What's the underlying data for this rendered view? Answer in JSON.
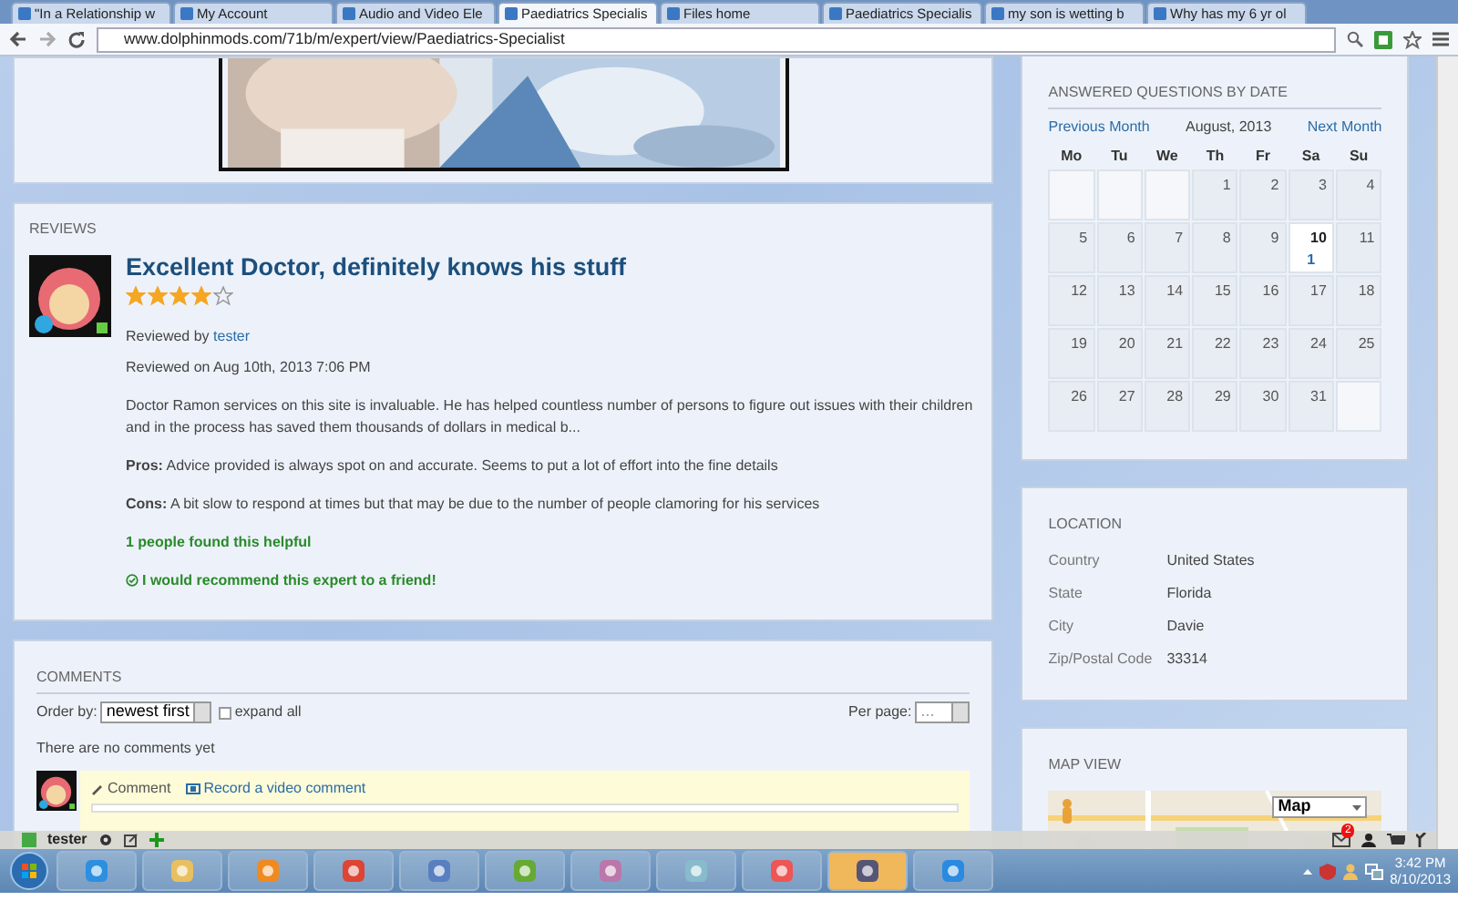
{
  "browser": {
    "tabs": [
      {
        "label": "\"In a Relationship w",
        "selected": false
      },
      {
        "label": "My Account",
        "selected": false
      },
      {
        "label": "Audio and Video Ele",
        "selected": false
      },
      {
        "label": "Paediatrics Specialis",
        "selected": true
      },
      {
        "label": "Files home",
        "selected": false
      },
      {
        "label": "Paediatrics Specialis",
        "selected": false
      },
      {
        "label": "my son is wetting b",
        "selected": false
      },
      {
        "label": "Why has my 6 yr ol",
        "selected": false
      }
    ],
    "url": "www.dolphinmods.com/71b/m/expert/view/Paediatrics-Specialist"
  },
  "reviews": {
    "heading": "REVIEWS",
    "title": "Excellent Doctor, definitely knows his stuff",
    "stars": 4,
    "reviewed_by_label": "Reviewed by",
    "reviewer": "tester",
    "reviewed_on": "Reviewed on Aug 10th, 2013 7:06 PM",
    "body": "Doctor Ramon services on this site is invaluable. He has helped countless number of persons to figure out issues with their children and in the process has saved them thousands of dollars in medical b...",
    "pros": "**Pros:** Advice provided is always spot on and accurate. Seems to put a lot of effort into the fine details",
    "cons": "**Cons:** A bit slow to respond at times but that may be due to the number of people clamoring for his services",
    "helpful": "1 people found this helpful",
    "recommend": "I would recommend this expert to a friend!"
  },
  "comments": {
    "heading": "COMMENTS",
    "order_label": "Order by:",
    "order_value": "newest first",
    "expand_all": {
      "label": "expand all",
      "checked": false
    },
    "per_page_label": "Per page:",
    "per_page_value": "...",
    "empty": "There are no comments yet",
    "comment_tab": "Comment",
    "video_tab": "Record a video comment"
  },
  "calendar": {
    "heading": "ANSWERED QUESTIONS BY DATE",
    "prev": "Previous Month",
    "month": "August, 2013",
    "next": "Next Month",
    "weekdays": [
      "Mo",
      "Tu",
      "We",
      "Th",
      "Fr",
      "Sa",
      "Su"
    ],
    "weeks": [
      [
        {
          "kind": "blank"
        },
        {
          "kind": "blank"
        },
        {
          "kind": "blank"
        },
        {
          "kind": "day",
          "day": "1",
          "selected": false
        },
        {
          "kind": "day",
          "day": "2",
          "selected": false
        },
        {
          "kind": "day",
          "day": "3",
          "selected": false
        },
        {
          "kind": "day",
          "day": "4",
          "selected": false
        }
      ],
      [
        {
          "kind": "day",
          "day": "5",
          "selected": false
        },
        {
          "kind": "day",
          "day": "6",
          "selected": false
        },
        {
          "kind": "day",
          "day": "7",
          "selected": false
        },
        {
          "kind": "day",
          "day": "8",
          "selected": false
        },
        {
          "kind": "day",
          "day": "9",
          "selected": false
        },
        {
          "kind": "day",
          "day": "10",
          "count": "1",
          "selected": true
        },
        {
          "kind": "day",
          "day": "11",
          "selected": false
        }
      ],
      [
        {
          "kind": "day",
          "day": "12",
          "selected": false
        },
        {
          "kind": "day",
          "day": "13",
          "selected": false
        },
        {
          "kind": "day",
          "day": "14",
          "selected": false
        },
        {
          "kind": "day",
          "day": "15",
          "selected": false
        },
        {
          "kind": "day",
          "day": "16",
          "selected": false
        },
        {
          "kind": "day",
          "day": "17",
          "selected": false
        },
        {
          "kind": "day",
          "day": "18",
          "selected": false
        }
      ],
      [
        {
          "kind": "day",
          "day": "19",
          "selected": false
        },
        {
          "kind": "day",
          "day": "20",
          "selected": false
        },
        {
          "kind": "day",
          "day": "21",
          "selected": false
        },
        {
          "kind": "day",
          "day": "22",
          "selected": false
        },
        {
          "kind": "day",
          "day": "23",
          "selected": false
        },
        {
          "kind": "day",
          "day": "24",
          "selected": false
        },
        {
          "kind": "day",
          "day": "25",
          "selected": false
        }
      ],
      [
        {
          "kind": "day",
          "day": "26",
          "selected": false
        },
        {
          "kind": "day",
          "day": "27",
          "selected": false
        },
        {
          "kind": "day",
          "day": "28",
          "selected": false
        },
        {
          "kind": "day",
          "day": "29",
          "selected": false
        },
        {
          "kind": "day",
          "day": "30",
          "selected": false
        },
        {
          "kind": "day",
          "day": "31",
          "selected": false
        },
        {
          "kind": "blank"
        }
      ]
    ]
  },
  "location": {
    "heading": "LOCATION",
    "rows": [
      {
        "label": "Country",
        "value": "United States"
      },
      {
        "label": "State",
        "value": "Florida"
      },
      {
        "label": "City",
        "value": "Davie"
      },
      {
        "label": "Zip/Postal Code",
        "value": "33314"
      }
    ]
  },
  "map": {
    "heading": "MAP VIEW",
    "type_select": "Map"
  },
  "user_bar": {
    "username": "tester",
    "mail_badge": "2"
  },
  "taskbar": {
    "time": "3:42 PM",
    "date": "8/10/2013"
  }
}
